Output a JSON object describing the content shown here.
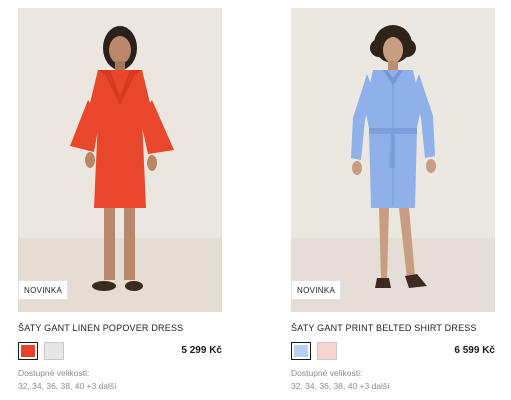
{
  "products": [
    {
      "badge": "NOVINKA",
      "title": "ŠATY GANT LINEN POPOVER DRESS",
      "price": "5 299 Kč",
      "colors": [
        "#e5432b",
        "#e6e6e6"
      ],
      "active_color": "red",
      "sizes_label": "Dostupné velikosti:",
      "sizes": "32, 34, 36, 38, 40 +3 další",
      "image_subject": "model-in-red-linen-dress"
    },
    {
      "badge": "NOVINKA",
      "title": "ŠATY GANT PRINT BELTED SHIRT DRESS",
      "price": "6 599 Kč",
      "colors": [
        "#b7d0f4",
        "#f7d4cf"
      ],
      "active_color": "light-blue",
      "sizes_label": "Dostupné velikosti:",
      "sizes": "32, 34, 36, 38, 40 +3 další",
      "image_subject": "model-in-blue-belted-shirt-dress"
    }
  ]
}
